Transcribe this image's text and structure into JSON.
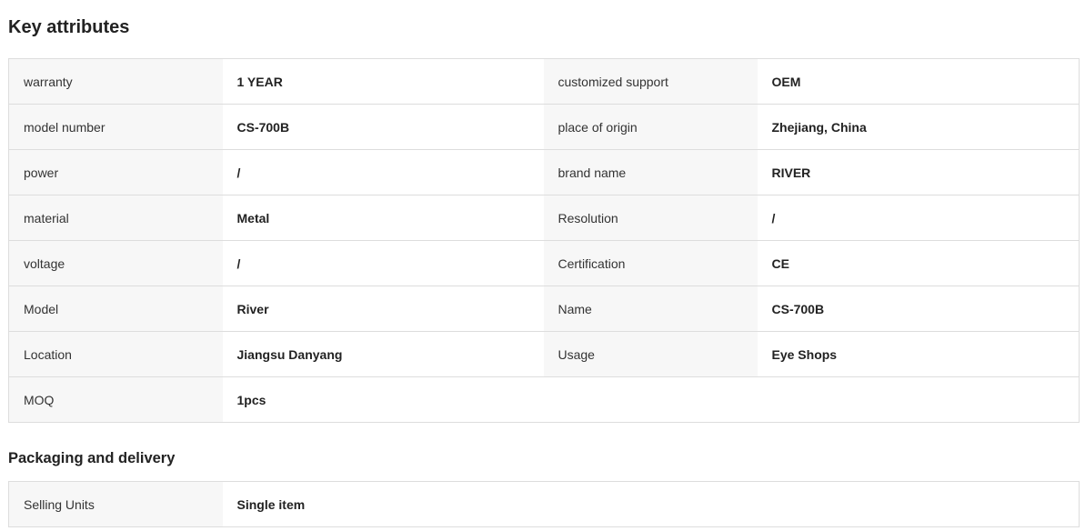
{
  "key_attributes": {
    "title": "Key attributes",
    "rows": [
      {
        "k1": "warranty",
        "v1": "1 YEAR",
        "k2": "customized support",
        "v2": "OEM"
      },
      {
        "k1": "model number",
        "v1": "CS-700B",
        "k2": "place of origin",
        "v2": "Zhejiang, China"
      },
      {
        "k1": "power",
        "v1": "/",
        "k2": "brand name",
        "v2": "RIVER"
      },
      {
        "k1": "material",
        "v1": "Metal",
        "k2": "Resolution",
        "v2": "/"
      },
      {
        "k1": "voltage",
        "v1": "/",
        "k2": "Certification",
        "v2": "CE"
      },
      {
        "k1": "Model",
        "v1": "River",
        "k2": "Name",
        "v2": "CS-700B"
      },
      {
        "k1": "Location",
        "v1": "Jiangsu Danyang",
        "k2": "Usage",
        "v2": "Eye Shops"
      },
      {
        "k1": "MOQ",
        "v1": "1pcs",
        "k2": "",
        "v2": ""
      }
    ]
  },
  "packaging": {
    "title": "Packaging and delivery",
    "rows": [
      {
        "k1": "Selling Units",
        "v1": "Single item"
      }
    ]
  }
}
